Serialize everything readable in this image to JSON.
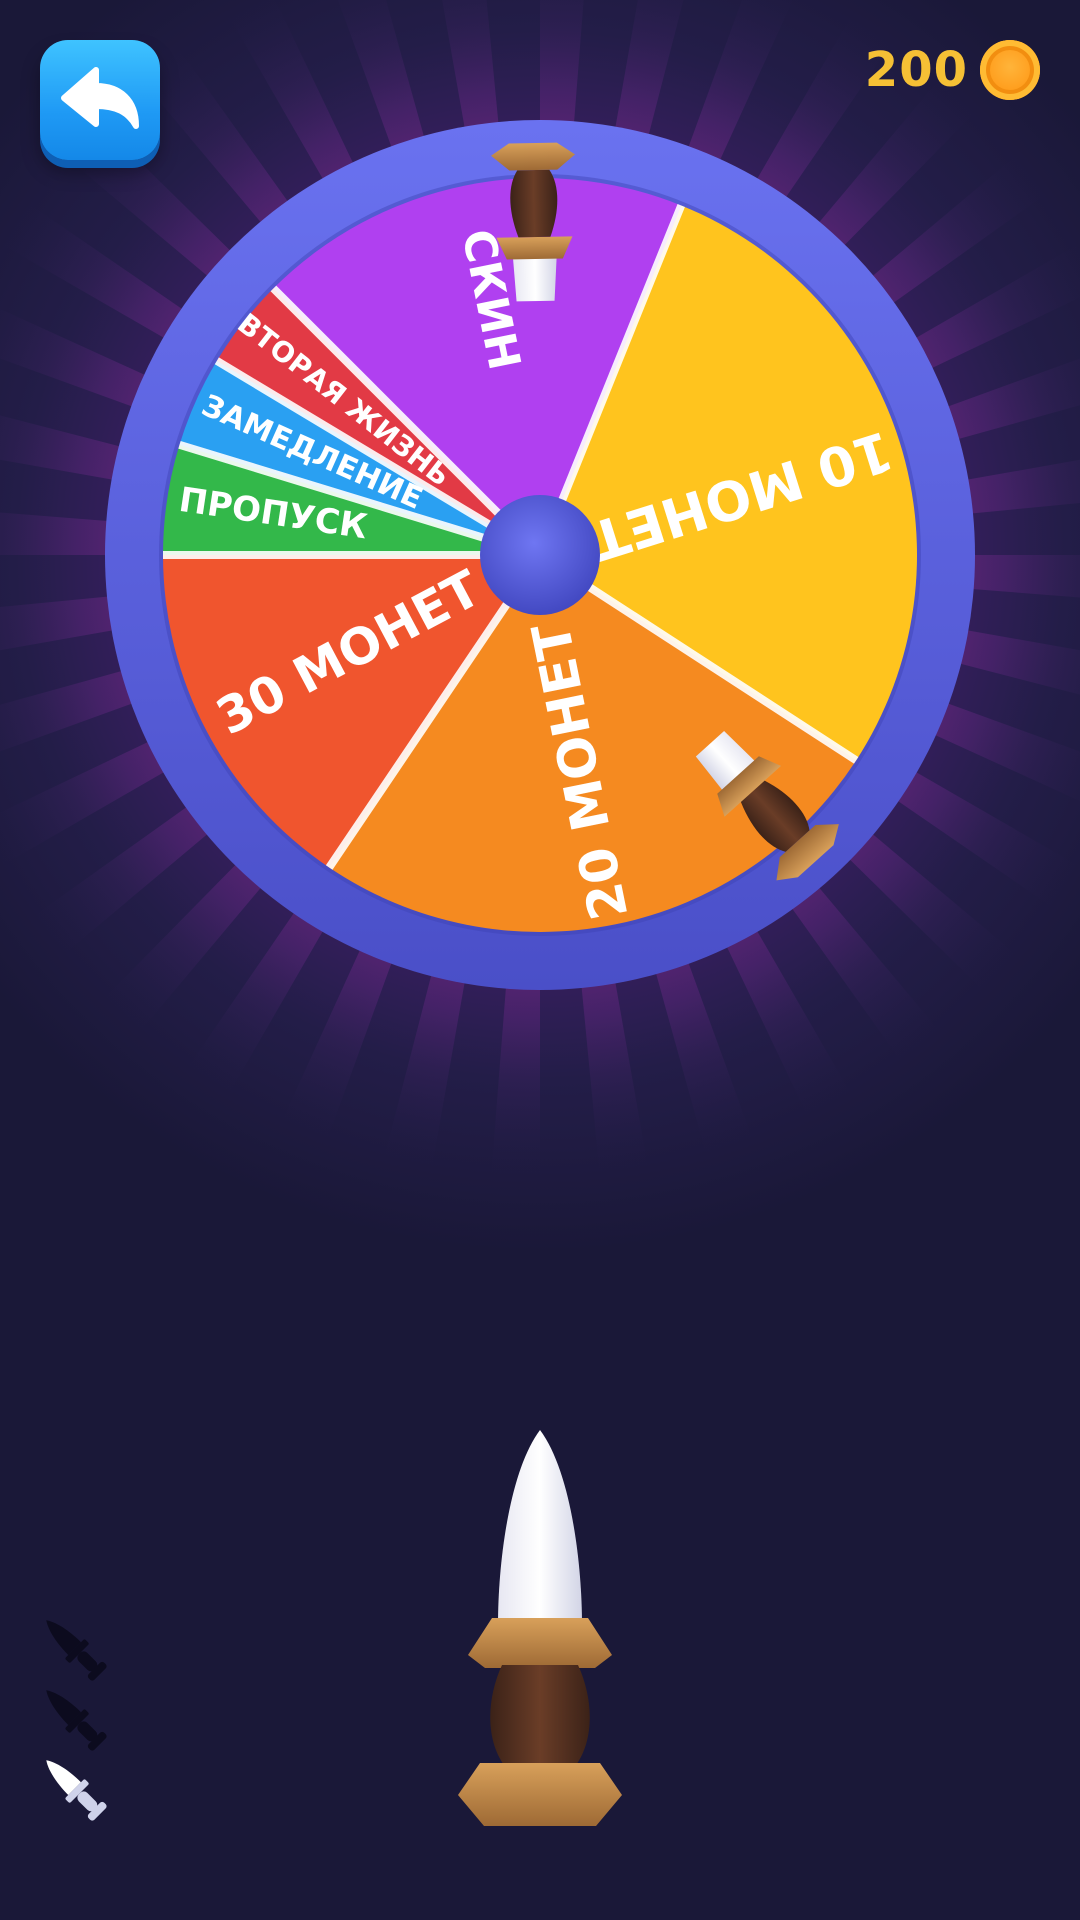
{
  "header": {
    "back_icon": "undo-arrow-icon",
    "coins_value": "200",
    "coin_icon": "gold-coin-icon"
  },
  "wheel": {
    "segments": [
      {
        "label": "10 МОНЕТ",
        "color": "#ffc41e"
      },
      {
        "label": "20 МОНЕТ",
        "color": "#f58a20"
      },
      {
        "label": "30 МОНЕТ",
        "color": "#f0552e"
      },
      {
        "label": "ПРОПУСК",
        "color": "#33b84a"
      },
      {
        "label": "ЗАМЕДЛЕНИЕ",
        "color": "#2aa0f2"
      },
      {
        "label": "ВТОРАЯ ЖИЗНЬ",
        "color": "#e23a45"
      },
      {
        "label": "СКИН",
        "color": "#b040f0"
      }
    ],
    "stuck_knives": 2
  },
  "player": {
    "knife_icon": "dagger-icon",
    "knives_remaining": 1,
    "knives_total": 3
  },
  "colors": {
    "background": "#1a1838",
    "rim": "#5b62e0",
    "coin_text": "#f5c035",
    "accent_blue": "#1f9af5"
  }
}
